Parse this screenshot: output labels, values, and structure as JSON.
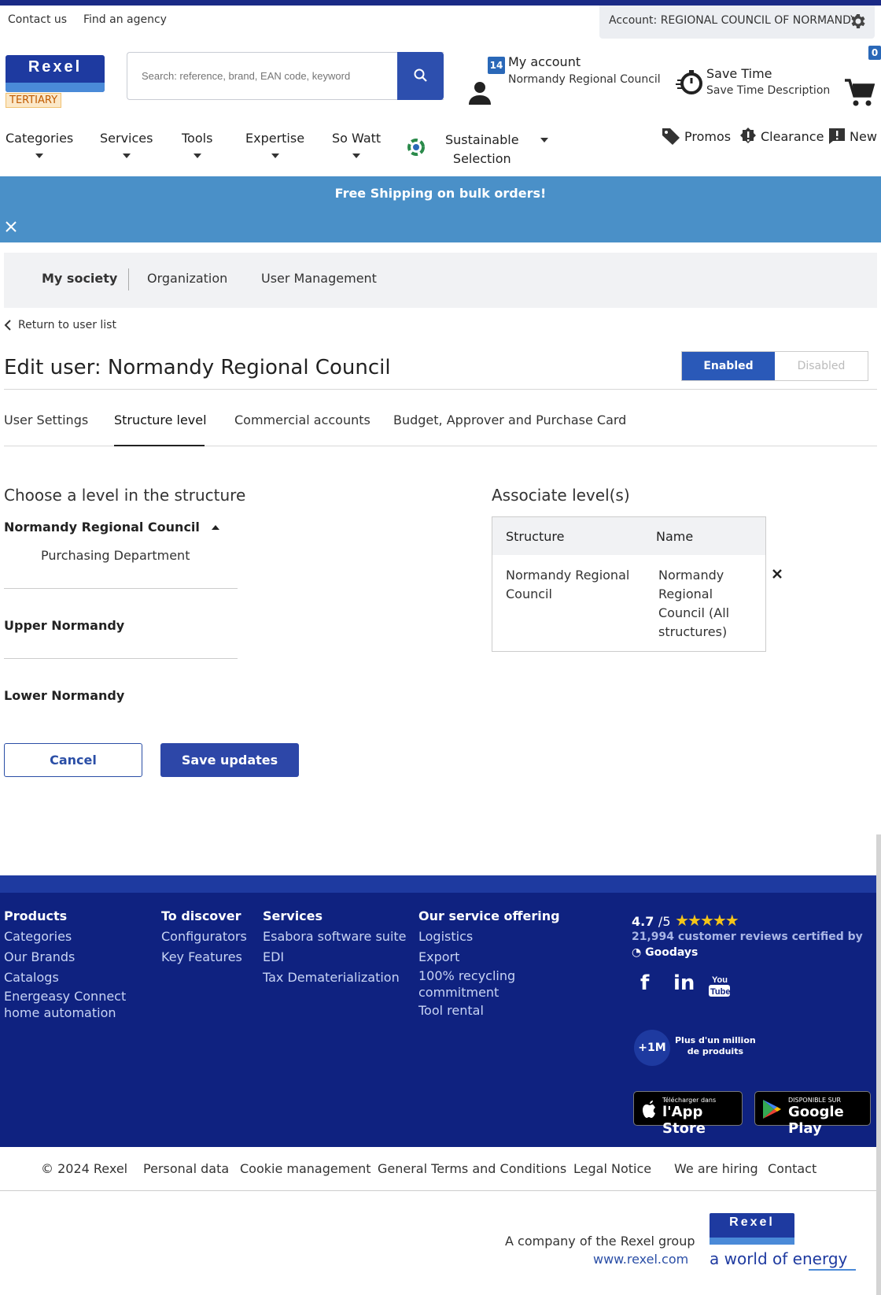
{
  "utility": {
    "contact_us": "Contact us",
    "find_agency": "Find an agency",
    "account_label": "Account: REGIONAL COUNCIL OF NORMANDY"
  },
  "header": {
    "logo_text": "Rexel",
    "tertiary_badge": "TERTIARY",
    "search_placeholder": "Search: reference, brand, EAN code, keyword",
    "account_badge": "14",
    "account_title": "My account",
    "account_sub": "Normandy Regional Council",
    "savetime_title": "Save Time",
    "savetime_sub": "Save Time Description",
    "cart_count": "0"
  },
  "nav": {
    "items": [
      "Categories",
      "Services",
      "Tools",
      "Expertise",
      "So Watt"
    ],
    "sustainable_line1": "Sustainable",
    "sustainable_line2": "Selection",
    "promos": "Promos",
    "clearance": "Clearance",
    "new": "New"
  },
  "banner": {
    "message": "Free Shipping on bulk orders!"
  },
  "subnav": {
    "items": [
      "My society",
      "Organization",
      "User Management"
    ]
  },
  "page": {
    "back_link": "Return to user list",
    "title": "Edit user: Normandy Regional Council",
    "status_enabled": "Enabled",
    "status_disabled": "Disabled",
    "tabs": [
      "User Settings",
      "Structure level",
      "Commercial accounts",
      "Budget, Approver and Purchase Card"
    ],
    "active_tab": "Structure level"
  },
  "structure": {
    "title": "Choose a level in the structure",
    "root": "Normandy Regional Council",
    "child": "Purchasing Department",
    "upper": "Upper Normandy",
    "lower": "Lower Normandy"
  },
  "associate": {
    "title": "Associate level(s)",
    "col_structure": "Structure",
    "col_name": "Name",
    "row_structure": "Normandy Regional Council",
    "row_name": "Normandy Regional Council (All structures)"
  },
  "buttons": {
    "cancel": "Cancel",
    "save": "Save updates"
  },
  "footer": {
    "products": {
      "heading": "Products",
      "items": [
        "Categories",
        "Our Brands",
        "Catalogs",
        "Energeasy Connect home automation"
      ]
    },
    "discover": {
      "heading": "To discover",
      "items": [
        "Configurators",
        "Key Features"
      ]
    },
    "services": {
      "heading": "Services",
      "items": [
        "Esabora software suite",
        "EDI",
        "Tax Dematerialization"
      ]
    },
    "offering": {
      "heading": "Our service offering",
      "items": [
        "Logistics",
        "Export",
        "100% recycling commitment",
        "Tool rental"
      ]
    },
    "rating_value": "4.7",
    "rating_scale": "/5",
    "reviews": "21,994 customer reviews certified by",
    "goodays": "Goodays",
    "million_badge": "+1M",
    "million_line1": "Plus d'un million",
    "million_line2": "de produits",
    "appstore_small": "Télécharger dans",
    "appstore_big": "l'App Store",
    "gplay_small": "DISPONIBLE SUR",
    "gplay_big": "Google Play"
  },
  "legal": {
    "copyright": "© 2024 Rexel",
    "links": [
      "Personal data",
      "Cookie management",
      "General Terms and Conditions",
      "Legal Notice",
      "We are hiring",
      "Contact"
    ]
  },
  "bottom": {
    "company": "A company of the Rexel group",
    "site": "www.rexel.com",
    "logo_text": "Rexel",
    "slogan": "a world of energy"
  },
  "colors": {
    "brand_blue": "#1e3aa0",
    "banner_blue": "#4a90c8",
    "footer_navy": "#0f2280",
    "star_gold": "#f5c518"
  }
}
